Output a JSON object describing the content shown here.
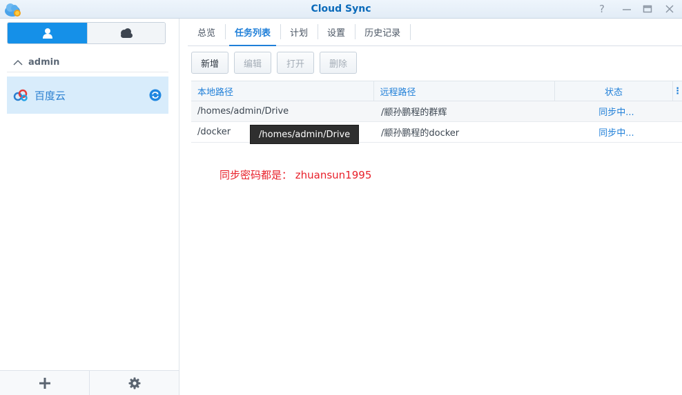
{
  "window": {
    "title": "Cloud Sync",
    "help_glyph": "?"
  },
  "left_panel": {
    "group": {
      "label": "admin"
    },
    "accounts": [
      {
        "name": "百度云",
        "status": "syncing"
      }
    ]
  },
  "tabs": [
    {
      "label": "总览",
      "active": false
    },
    {
      "label": "任务列表",
      "active": true
    },
    {
      "label": "计划",
      "active": false
    },
    {
      "label": "设置",
      "active": false
    },
    {
      "label": "历史记录",
      "active": false
    }
  ],
  "toolbar": {
    "add_label": "新增",
    "edit_label": "编辑",
    "open_label": "打开",
    "delete_label": "删除"
  },
  "table": {
    "columns": {
      "local": "本地路径",
      "remote": "远程路径",
      "status": "状态",
      "menu": "⋮"
    },
    "rows": [
      {
        "local": "/homes/admin/Drive",
        "remote": "/颛孙鹏程的群辉",
        "status": "同步中..."
      },
      {
        "local": "/docker",
        "remote": "/颛孙鹏程的docker",
        "status": "同步中..."
      }
    ]
  },
  "tooltip": {
    "text": "/homes/admin/Drive"
  },
  "annotation": {
    "text": "同步密码都是：  zhuansun1995"
  },
  "colors": {
    "accent": "#1f7fd8",
    "title": "#0a6aba",
    "selected_bg": "#d8ecfb",
    "annotation": "#e8202a"
  },
  "icons": {
    "app": "cloud-sync-app-icon",
    "user_toggle": "user-icon",
    "cloud_toggle": "cloud-icon",
    "group": "chevron-up-icon",
    "account": "baidu-cloud-logo-icon",
    "sync": "sync-icon",
    "add": "plus-icon",
    "settings": "gear-icon"
  }
}
